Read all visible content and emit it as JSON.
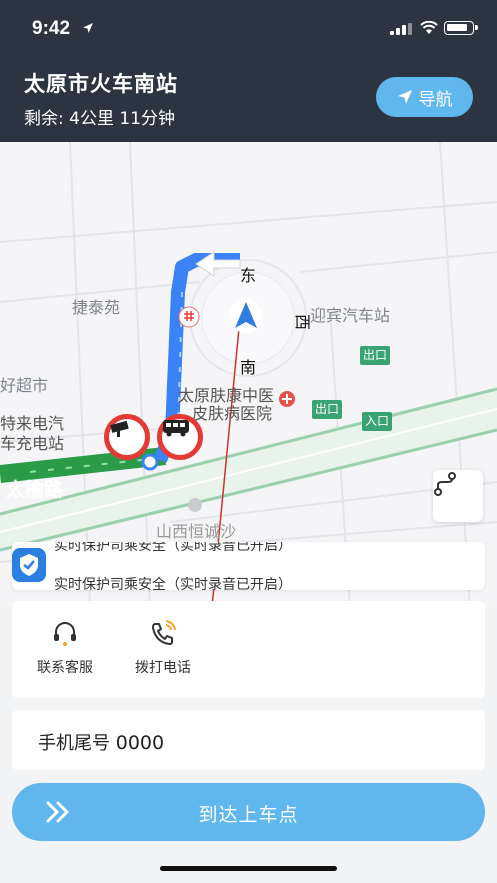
{
  "status_bar": {
    "time": "9:42"
  },
  "header": {
    "destination": "太原市火车南站",
    "remaining": "剩余:  4公里   11分钟",
    "nav_button": "导航",
    "colors": {
      "bg": "#2c3442",
      "accent": "#5fb7ee"
    }
  },
  "map": {
    "labels": {
      "jietaiyuan": "捷泰苑",
      "yingbin": "迎宾汽车站",
      "supermarket": "好超市",
      "ev_station_1": "特来电汽",
      "ev_station_2": "车充电站",
      "hospital_1": "太原肤康中医",
      "hospital_2": "皮肤病医院",
      "road": "太榆路",
      "hengcheng_1": "山西恒诚沙",
      "direction_east": "东",
      "direction_south": "南",
      "direction_west": "西"
    },
    "exit_badges": [
      "出口",
      "出口",
      "入口"
    ],
    "icons": [
      "camera-icon",
      "bus-icon",
      "route-icon",
      "nav-arrow-icon",
      "railway-icon",
      "hospital-icon"
    ]
  },
  "safety": {
    "line1": "实时保护司乘安全（实时录音已开启）",
    "line2": "实时保护司乘安全（实时录音已开启）"
  },
  "actions": {
    "contact_service": "联系客服",
    "make_call": "拨打电话"
  },
  "phone": {
    "label": "手机尾号 ",
    "number": "0000"
  },
  "arrive_button": "到达上车点"
}
